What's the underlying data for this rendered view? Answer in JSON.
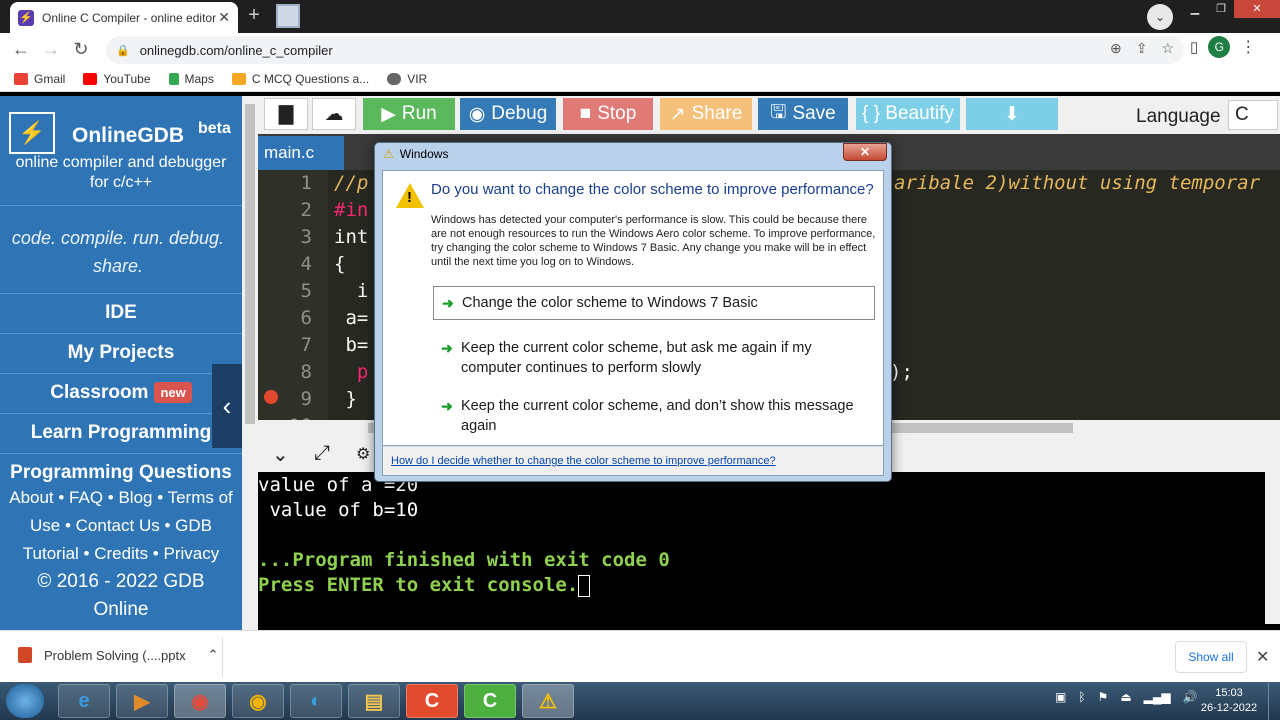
{
  "browser": {
    "tab_title": "Online C Compiler - online editor",
    "url": "onlinegdb.com/online_c_compiler",
    "avatar_letter": "G",
    "bookmarks": [
      "Gmail",
      "YouTube",
      "Maps",
      "C MCQ Questions a...",
      "VIR"
    ]
  },
  "sidebar": {
    "brand": "OnlineGDB",
    "beta": "beta",
    "tagline_line1": "online compiler and debugger",
    "tagline_line2": "for c/c++",
    "motto_line1": "code. compile. run. debug.",
    "motto_line2": "share.",
    "nav": [
      "IDE",
      "My Projects",
      "Classroom",
      "Learn Programming",
      "Programming Questions"
    ],
    "new_badge": "new",
    "links_line1": "About • FAQ • Blog • Terms of",
    "links_line2": "Use • Contact Us • GDB",
    "links_line3": "Tutorial • Credits • Privacy",
    "links_line4": "© 2016 - 2022 GDB",
    "links_line5": "Online"
  },
  "toolbar": {
    "run": "Run",
    "debug": "Debug",
    "stop": "Stop",
    "share": "Share",
    "save": "Save",
    "beautify": "{ } Beautify",
    "language_label": "Language",
    "language_value": "C",
    "colors": {
      "run": "#5cb85c",
      "debug": "#337ab7",
      "stop": "#d9534f",
      "share": "#f0ad4e",
      "save": "#337ab7",
      "beautify": "#5bc0de",
      "download": "#5bc0de"
    }
  },
  "editor": {
    "file_tab": "main.c",
    "line_numbers": [
      "1",
      "2",
      "3",
      "4",
      "5",
      "6",
      "7",
      "8",
      "9",
      "10"
    ],
    "lines": [
      "//p",
      "#in",
      "int",
      "{",
      "  i",
      " a=",
      " b=",
      "  p",
      " }",
      ""
    ],
    "right_fragment": "aribale 2)without using temporar",
    "right_fragment_line8": ");"
  },
  "console": {
    "line1": "value of a =20",
    "line2": " value of b=10",
    "line3": "...Program finished with exit code 0",
    "line4": "Press ENTER to exit console."
  },
  "dialog": {
    "title": "Windows",
    "question": "Do you want to change the color scheme to improve performance?",
    "detail": "Windows has detected your computer's performance is slow. This could be because there are not enough resources to run the Windows Aero color scheme. To improve performance, try changing the color scheme to Windows 7 Basic. Any change you make will be in effect until the next time you log on to Windows.",
    "options": [
      "Change the color scheme to Windows 7 Basic",
      "Keep the current color scheme, but ask me again if my computer continues to perform slowly",
      "Keep the current color scheme, and don’t show this message again"
    ],
    "help_link": "How do I decide whether to change the color scheme to improve performance?"
  },
  "download_bar": {
    "file": "Problem Solving (....pptx",
    "show_all": "Show all"
  },
  "taskbar": {
    "time": "15:03",
    "date": "26-12-2022"
  }
}
